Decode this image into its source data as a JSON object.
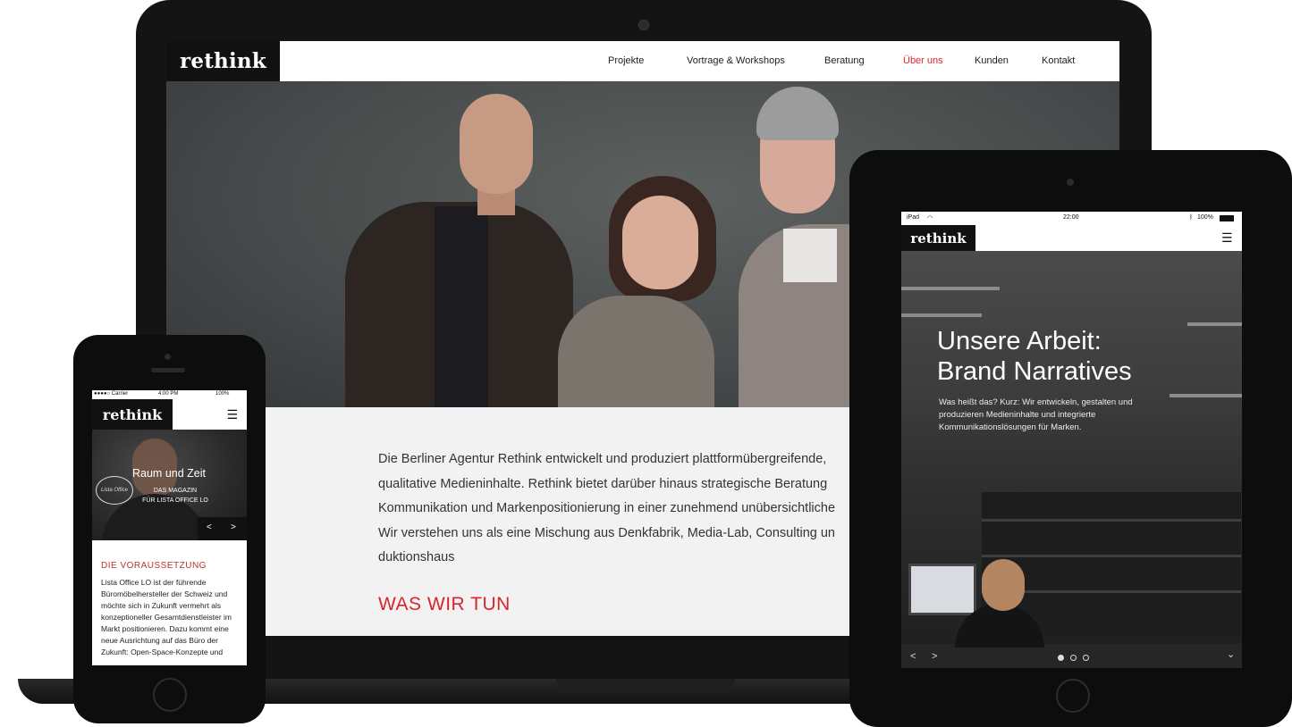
{
  "laptop": {
    "site": {
      "logo": "rethink",
      "nav": [
        {
          "label": "Projekte",
          "active": false
        },
        {
          "label": "Vortrage & Workshops",
          "active": false
        },
        {
          "label": "Beratung",
          "active": false
        },
        {
          "label": "Über uns",
          "active": true
        },
        {
          "label": "Kunden",
          "active": false
        },
        {
          "label": "Kontakt",
          "active": false
        }
      ],
      "intro_lines": [
        "Die Berliner Agentur Rethink entwickelt und produziert plattformübergreifende,",
        "qualitative Medieninhalte. Rethink bietet darüber hinaus strategische Beratung",
        "Kommunikation und Markenpositionierung in einer zunehmend unübersichtliche",
        "Wir verstehen uns als eine Mischung aus Denkfabrik, Media-Lab, Consulting un",
        "duktionshaus"
      ],
      "section_heading": "WAS WIR TUN",
      "accent_color": "#d6262c"
    }
  },
  "tablet": {
    "status": {
      "device": "iPad",
      "time": "22:00",
      "battery": "100%"
    },
    "logo": "rethink",
    "headline_line1": "Unsere Arbeit:",
    "headline_line2": "Brand Narratives",
    "description": "Was heißt das? Kurz: Wir entwickeln, gestalten und produzieren Medieninhalte und integrierte Kommunikationslösungen für Marken.",
    "controls": {
      "prev": "<",
      "next": ">",
      "expand": "⌄",
      "slide_count": 3,
      "active_slide": 1
    }
  },
  "phone": {
    "status": {
      "carrier": "●●●●○ Carrier",
      "time": "4:00 PM",
      "battery": "100%"
    },
    "logo": "rethink",
    "hero_title": "Raum und Zeit",
    "hero_subtitle_line1": "DAS MAGAZIN",
    "hero_subtitle_line2": "FÜR LISTA OFFICE LO",
    "hero_signature": "Lista Office",
    "prev": "<",
    "next": ">",
    "section_heading": "DIE VORAUSSETZUNG",
    "body": "Lista Office LO ist der führende Büromöbelhersteller der Schweiz und möchte sich in Zukunft vermehrt als konzeptioneller Gesamtdienstleister im Markt positionieren. Dazu kommt eine neue Ausrichtung auf das Büro der Zukunft: Open-Space-Konzepte und"
  }
}
